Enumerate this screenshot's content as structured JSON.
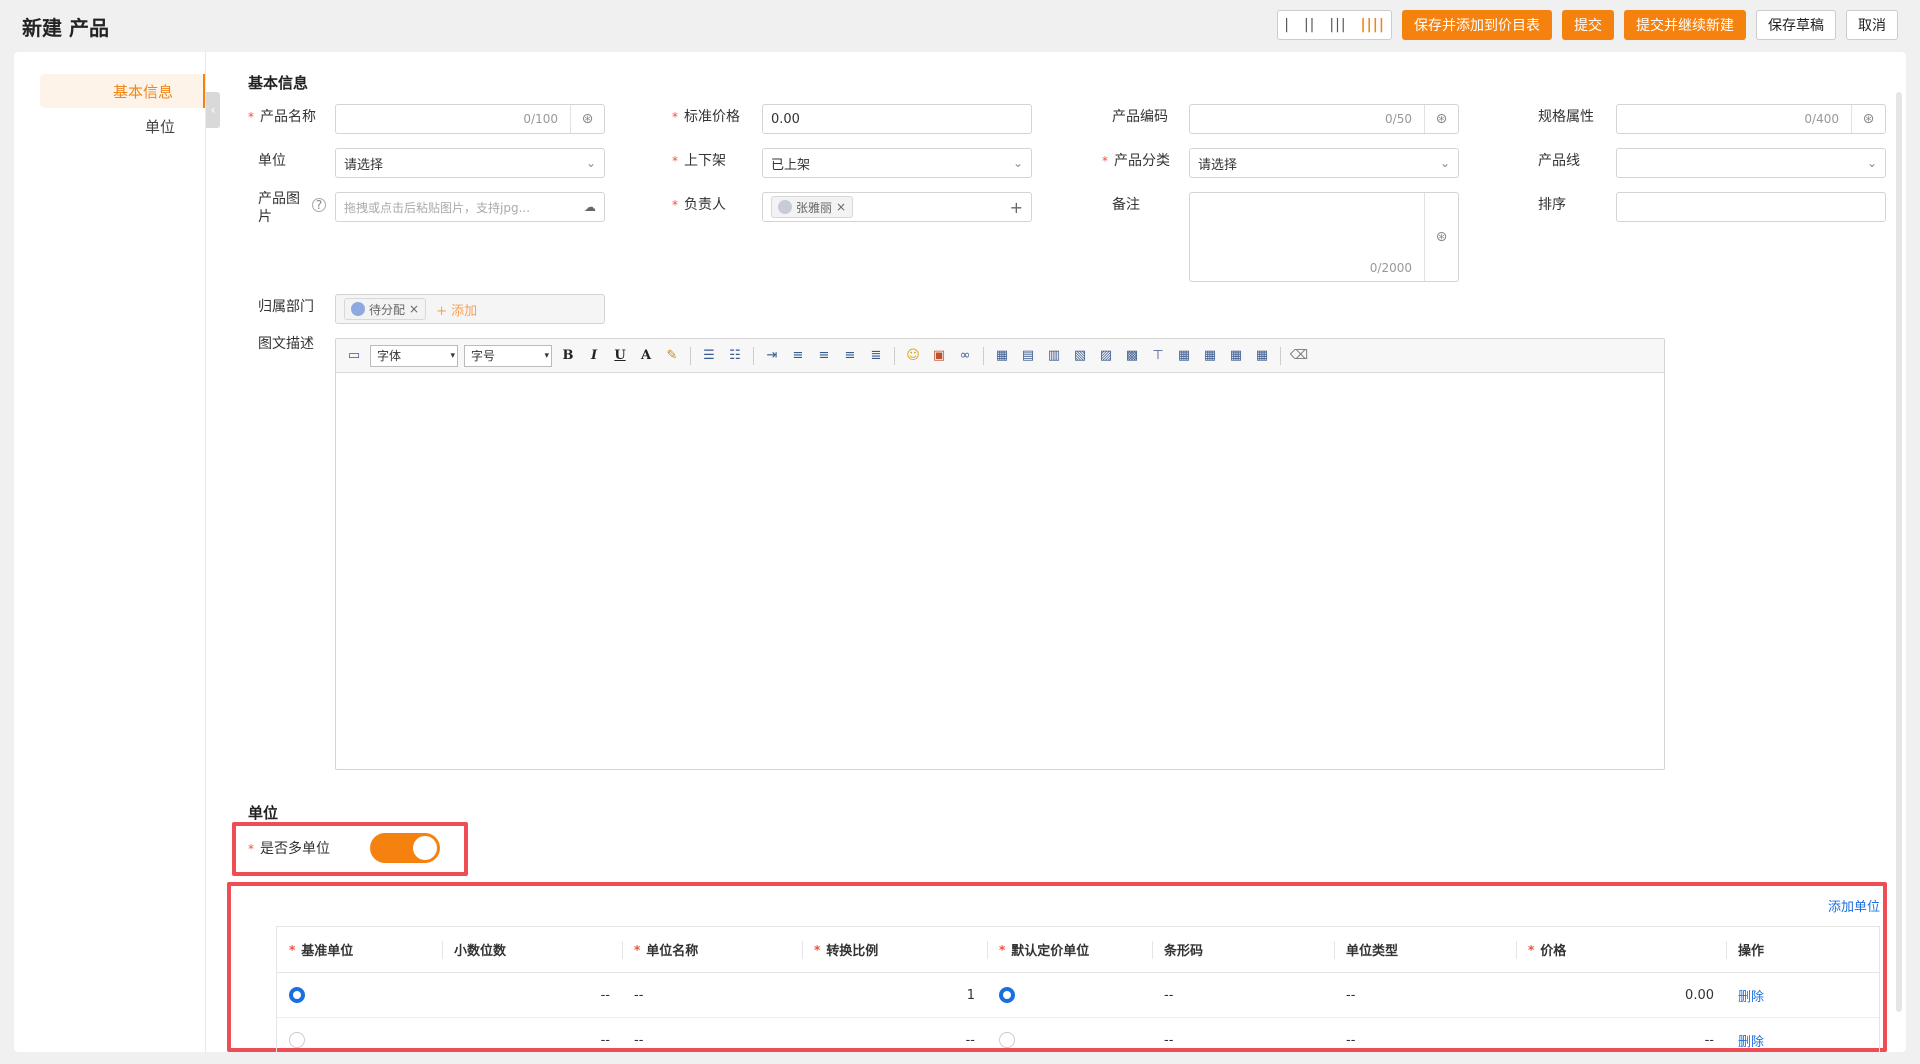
{
  "header": {
    "title": "新建 产品",
    "layout_options": [
      "|",
      "||",
      "|||",
      "||||"
    ],
    "buttons": {
      "save_add_pricelist": "保存并添加到价目表",
      "submit": "提交",
      "submit_continue": "提交并继续新建",
      "save_draft": "保存草稿",
      "cancel": "取消"
    }
  },
  "sidebar": {
    "items": [
      {
        "label": "基本信息"
      },
      {
        "label": "单位"
      }
    ],
    "collapse_glyph": "‹"
  },
  "basic": {
    "section_title": "基本信息",
    "product_name": {
      "label": "产品名称",
      "counter": "0/100"
    },
    "standard_price": {
      "label": "标准价格",
      "value": "0.00"
    },
    "product_code": {
      "label": "产品编码",
      "counter": "0/50"
    },
    "spec_attr": {
      "label": "规格属性",
      "counter": "0/400"
    },
    "unit": {
      "label": "单位",
      "value": "请选择"
    },
    "shelf_status": {
      "label": "上下架",
      "value": "已上架"
    },
    "category": {
      "label": "产品分类",
      "value": "请选择"
    },
    "product_line": {
      "label": "产品线",
      "value": ""
    },
    "product_image": {
      "label": "产品图片",
      "placeholder": "拖拽或点击后粘贴图片，支持jpg..."
    },
    "owner": {
      "label": "负责人",
      "tag": "张雅丽"
    },
    "remark": {
      "label": "备注",
      "counter": "0/2000"
    },
    "sort": {
      "label": "排序",
      "value": ""
    },
    "department": {
      "label": "归属部门",
      "tag": "待分配",
      "add": "+ 添加"
    },
    "rich_desc": {
      "label": "图文描述"
    }
  },
  "editor": {
    "font_select": "字体",
    "size_select": "字号",
    "bold": "B",
    "italic": "I",
    "underline": "U",
    "font_color": "A"
  },
  "units": {
    "section_title": "单位",
    "multi_unit_label": "是否多单位",
    "multi_unit_on": true,
    "add_unit": "添加单位",
    "columns": [
      {
        "label": "基准单位",
        "required": "*"
      },
      {
        "label": "小数位数",
        "required": ""
      },
      {
        "label": "单位名称",
        "required": "*"
      },
      {
        "label": "转换比例",
        "required": "*"
      },
      {
        "label": "默认定价单位",
        "required": "*"
      },
      {
        "label": "条形码",
        "required": ""
      },
      {
        "label": "单位类型",
        "required": ""
      },
      {
        "label": "价格",
        "required": "*"
      },
      {
        "label": "操作",
        "required": ""
      }
    ],
    "rows": [
      {
        "base": true,
        "decimals": "--",
        "name": "--",
        "ratio": "1",
        "default_price": true,
        "barcode": "--",
        "type": "--",
        "price": "0.00",
        "action": "删除"
      },
      {
        "base": false,
        "decimals": "--",
        "name": "--",
        "ratio": "--",
        "default_price": false,
        "barcode": "--",
        "type": "--",
        "price": "--",
        "action": "删除"
      }
    ]
  },
  "colors": {
    "accent": "#f5820e",
    "link": "#1a6fe0",
    "highlight": "#ee4d55"
  }
}
